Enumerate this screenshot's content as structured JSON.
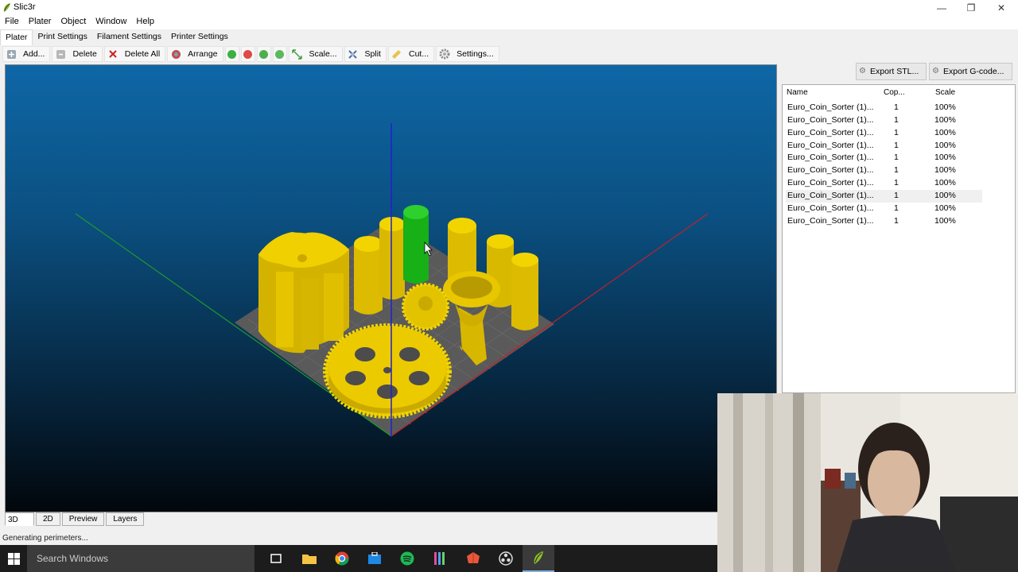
{
  "window": {
    "title": "Slic3r",
    "minimize_glyph": "—",
    "maximize_glyph": "❐",
    "close_glyph": "✕"
  },
  "menu": [
    "File",
    "Plater",
    "Object",
    "Window",
    "Help"
  ],
  "tabs": [
    "Plater",
    "Print Settings",
    "Filament Settings",
    "Printer Settings"
  ],
  "toolbar": {
    "add": "Add...",
    "delete": "Delete",
    "delete_all": "Delete All",
    "arrange": "Arrange",
    "scale": "Scale...",
    "split": "Split",
    "cut": "Cut...",
    "settings": "Settings..."
  },
  "export": {
    "stl": "Export STL...",
    "gcode": "Export G-code..."
  },
  "object_list": {
    "columns": [
      "Name",
      "Cop...",
      "Scale"
    ],
    "rows": [
      {
        "name": "Euro_Coin_Sorter (1)...",
        "copies": "1",
        "scale": "100%"
      },
      {
        "name": "Euro_Coin_Sorter (1)...",
        "copies": "1",
        "scale": "100%"
      },
      {
        "name": "Euro_Coin_Sorter (1)...",
        "copies": "1",
        "scale": "100%"
      },
      {
        "name": "Euro_Coin_Sorter (1)...",
        "copies": "1",
        "scale": "100%"
      },
      {
        "name": "Euro_Coin_Sorter (1)...",
        "copies": "1",
        "scale": "100%"
      },
      {
        "name": "Euro_Coin_Sorter (1)...",
        "copies": "1",
        "scale": "100%"
      },
      {
        "name": "Euro_Coin_Sorter (1)...",
        "copies": "1",
        "scale": "100%"
      },
      {
        "name": "Euro_Coin_Sorter (1)...",
        "copies": "1",
        "scale": "100%"
      },
      {
        "name": "Euro_Coin_Sorter (1)...",
        "copies": "1",
        "scale": "100%"
      },
      {
        "name": "Euro_Coin_Sorter (1)...",
        "copies": "1",
        "scale": "100%"
      }
    ],
    "selected_index": 7
  },
  "view_tabs": [
    "3D",
    "2D",
    "Preview",
    "Layers"
  ],
  "status": "Generating perimeters...",
  "taskbar": {
    "search_placeholder": "Search Windows",
    "apps": [
      "task-view-icon",
      "file-explorer-icon",
      "chrome-icon",
      "store-icon",
      "spotify-icon",
      "app-icon",
      "app-icon",
      "obs-icon",
      "slic3r-icon"
    ]
  },
  "colors": {
    "model_yellow": "#e8c400",
    "model_selected": "#1fbf1f",
    "axis_x": "#c2202a",
    "axis_y": "#1f9b2a",
    "axis_z": "#2020d0",
    "viewport_top": "#0e67a6",
    "viewport_bottom": "#02070c"
  }
}
